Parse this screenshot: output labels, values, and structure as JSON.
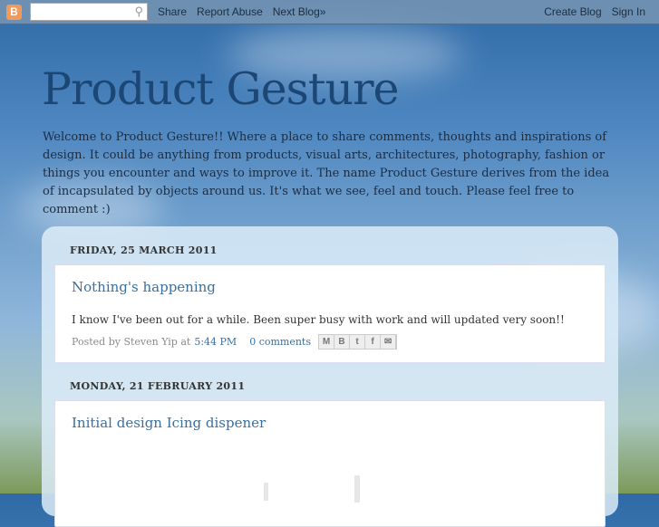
{
  "navbar": {
    "search_placeholder": "",
    "links": [
      "Share",
      "Report Abuse",
      "Next Blog»"
    ],
    "create": "Create Blog",
    "signin": "Sign In"
  },
  "blog": {
    "title": "Product Gesture",
    "description": "Welcome to Product Gesture!! Where a place to share comments, thoughts and inspirations of design. It could be anything from products, visual arts, architectures, photography, fashion or things you encounter and ways to improve it. The name Product Gesture derives from the idea of incapsulated by objects around us. It's what we see, feel and touch. Please feel free to comment :)"
  },
  "posts": [
    {
      "date": "FRIDAY, 25 MARCH 2011",
      "title": "Nothing's happening",
      "body": "I know I've been out for a while. Been super busy with work and will updated very soon!!",
      "posted_by": "Posted by Steven Yip at",
      "time": "5:44 PM",
      "comments": "0 comments",
      "share_icons": [
        "M",
        "B",
        "t",
        "f",
        "✉"
      ]
    },
    {
      "date": "MONDAY, 21 FEBRUARY 2011",
      "title": "Initial design Icing dispener"
    }
  ]
}
